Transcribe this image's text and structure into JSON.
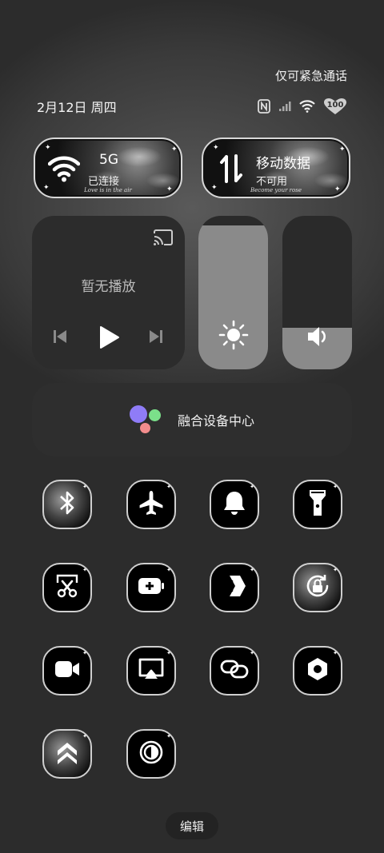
{
  "header": {
    "emergency_text": "仅可紧急通话",
    "date": "2月12日 周四",
    "battery_level": "100"
  },
  "wifi_card": {
    "network_label": "5G",
    "status": "已连接",
    "script_text": "Love is in the air"
  },
  "data_card": {
    "title": "移动数据",
    "status": "不可用",
    "script_text": "Become your rose"
  },
  "media": {
    "status": "暂无播放"
  },
  "brightness": {
    "level": 0.94
  },
  "volume": {
    "level": 0.27
  },
  "hub": {
    "label": "融合设备中心",
    "colors": {
      "purple": "#8f7cf7",
      "green": "#7be08a",
      "red": "#f28c8c"
    }
  },
  "tiles": [
    {
      "icon": "bluetooth-icon"
    },
    {
      "icon": "airplane-icon"
    },
    {
      "icon": "bell-icon"
    },
    {
      "icon": "flashlight-icon"
    },
    {
      "icon": "screenshot-scissors-icon"
    },
    {
      "icon": "battery-saver-icon"
    },
    {
      "icon": "share-arrow-icon"
    },
    {
      "icon": "rotation-lock-icon"
    },
    {
      "icon": "video-camera-icon"
    },
    {
      "icon": "screen-cast-icon"
    },
    {
      "icon": "link-icon"
    },
    {
      "icon": "settings-hex-icon"
    },
    {
      "icon": "ultra-save-icon"
    },
    {
      "icon": "dark-mode-icon"
    }
  ],
  "footer": {
    "edit_label": "编辑"
  }
}
